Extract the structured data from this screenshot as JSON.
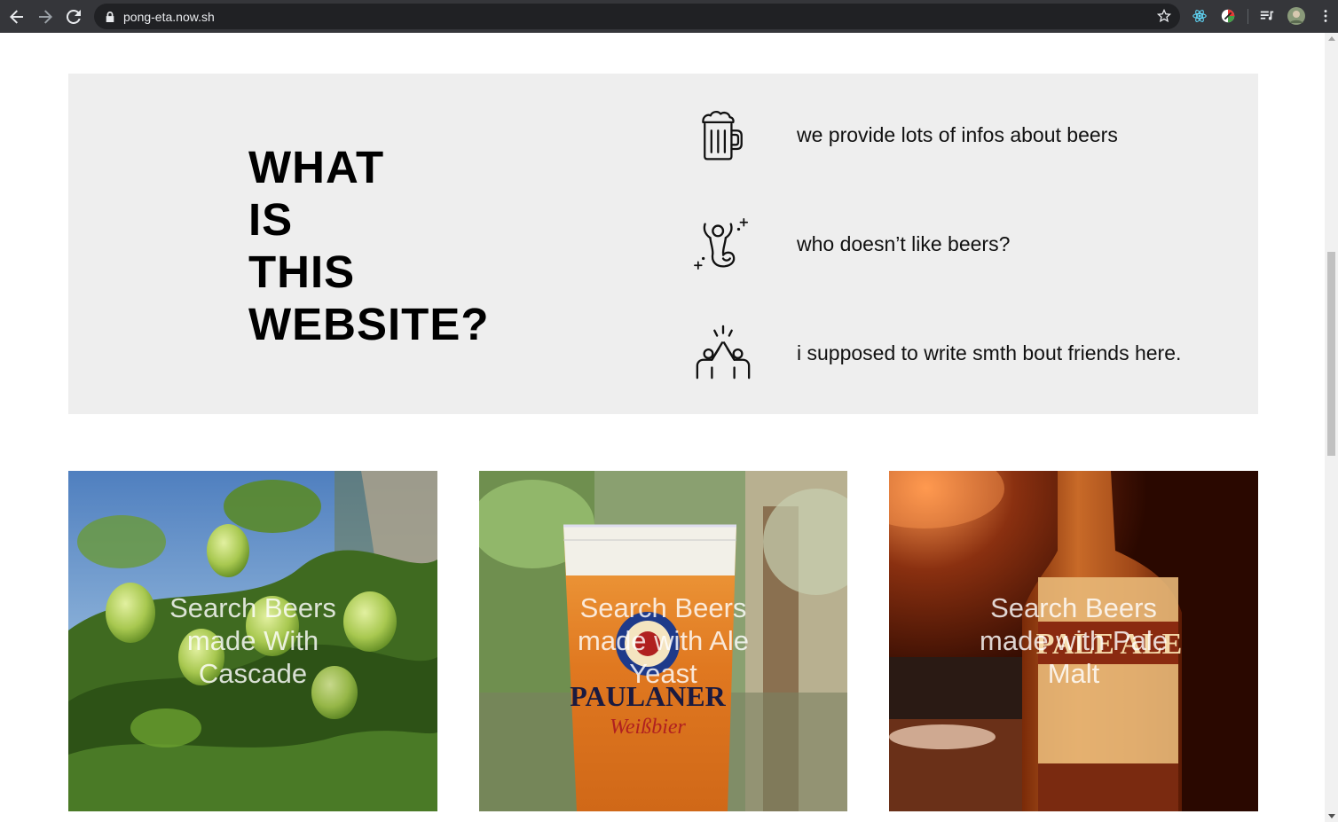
{
  "browser": {
    "url": "pong-eta.now.sh"
  },
  "about": {
    "heading_lines": [
      "WHAT",
      "IS",
      "THIS",
      "WEBSITE?"
    ],
    "features": [
      {
        "icon": "beer-mug-icon",
        "text": "we provide lots of infos about beers"
      },
      {
        "icon": "celebrating-person-icon",
        "text": "who doesn’t like beers?"
      },
      {
        "icon": "friends-high-five-icon",
        "text": "i supposed to write smth bout friends here."
      }
    ]
  },
  "cards": [
    {
      "label": "Search Beers made With Cascade",
      "theme": "hops"
    },
    {
      "label": "Search Beers made with Ale Yeast",
      "theme": "wheat-beer-glass"
    },
    {
      "label": "Search Beers made with Pale Malt",
      "theme": "pale-ale-bottle"
    }
  ],
  "colors": {
    "chrome_bg": "#35363a",
    "omnibox_bg": "#202124",
    "about_bg": "#eeeeee"
  }
}
